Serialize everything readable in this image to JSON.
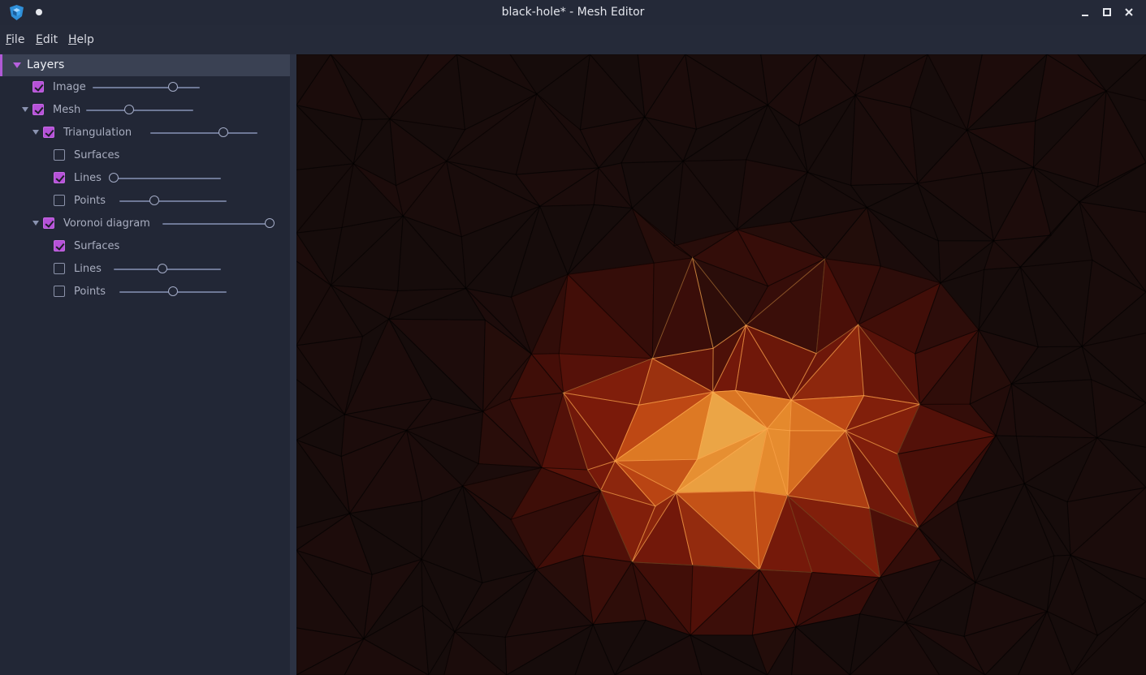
{
  "window": {
    "title": "black-hole* - Mesh Editor",
    "app_icon": "shield-cube-icon",
    "controls": [
      "minimize-icon",
      "maximize-icon",
      "close-icon"
    ]
  },
  "menu": {
    "file": {
      "mnemonic": "F",
      "rest": "ile"
    },
    "edit": {
      "mnemonic": "E",
      "rest": "dit"
    },
    "help": {
      "mnemonic": "H",
      "rest": "elp"
    }
  },
  "layers": {
    "title": "Layers",
    "items": [
      {
        "label": "Image",
        "checked": true,
        "expandable": false,
        "level": 0,
        "slider": 0.75
      },
      {
        "label": "Mesh",
        "checked": true,
        "expandable": true,
        "level": 0,
        "slider": 0.4
      },
      {
        "label": "Triangulation",
        "checked": true,
        "expandable": true,
        "level": 1,
        "slider": 0.68
      },
      {
        "label": "Surfaces",
        "checked": false,
        "expandable": false,
        "level": 2,
        "slider": null
      },
      {
        "label": "Lines",
        "checked": true,
        "expandable": false,
        "level": 2,
        "slider": 0.0
      },
      {
        "label": "Points",
        "checked": false,
        "expandable": false,
        "level": 2,
        "slider": 0.33
      },
      {
        "label": "Voronoi diagram",
        "checked": true,
        "expandable": true,
        "level": 1,
        "slider": 1.0
      },
      {
        "label": "Surfaces",
        "checked": true,
        "expandable": false,
        "level": 2,
        "slider": null
      },
      {
        "label": "Lines",
        "checked": false,
        "expandable": false,
        "level": 2,
        "slider": 0.46
      },
      {
        "label": "Points",
        "checked": false,
        "expandable": false,
        "level": 2,
        "slider": 0.5
      }
    ]
  },
  "colors": {
    "accent": "#b651d8",
    "glow_core": "#f3d98a",
    "glow_mid": "#e07a22",
    "glow_outer": "#6b1509",
    "background": "#130d0c"
  }
}
